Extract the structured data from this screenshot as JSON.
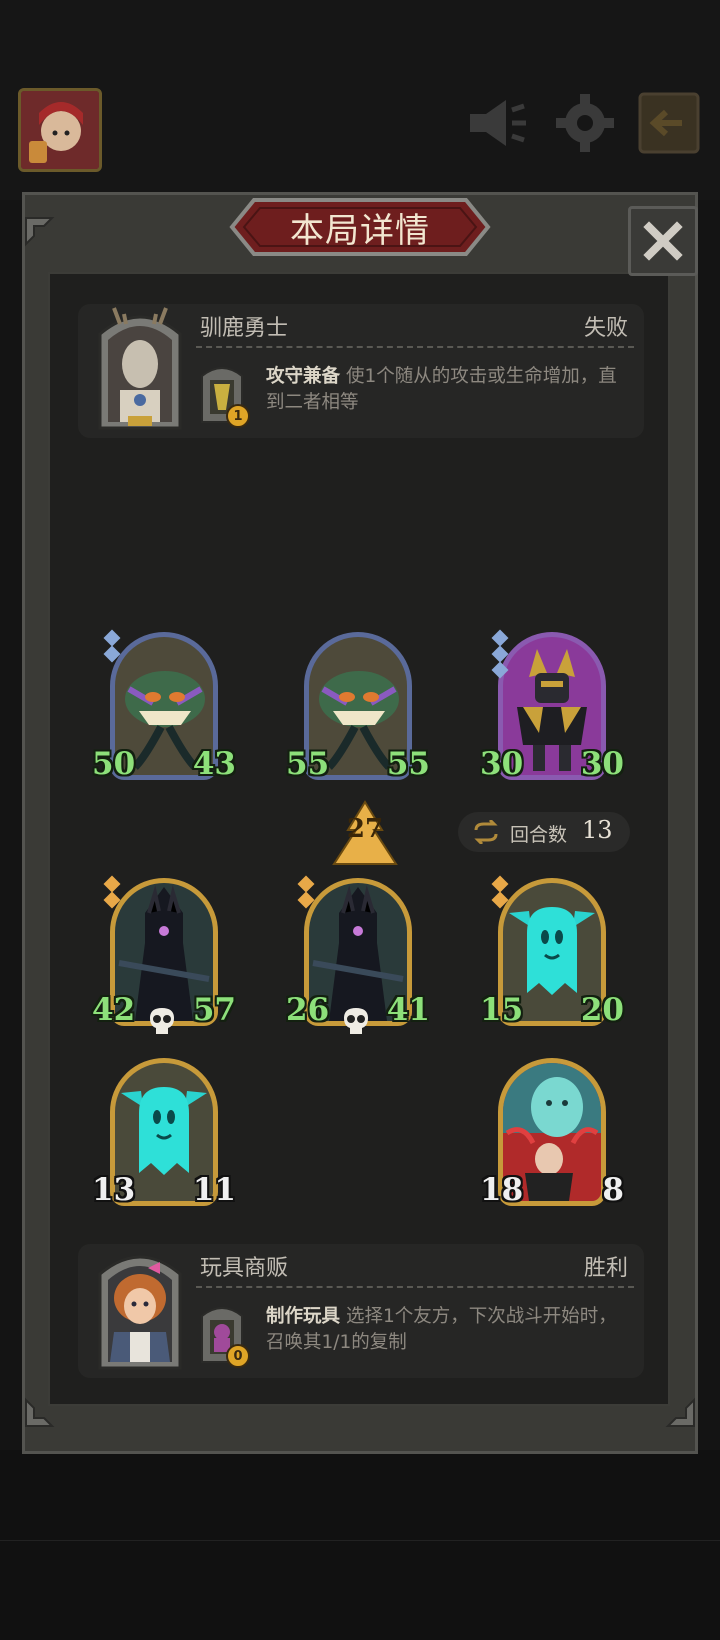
{
  "dialog": {
    "title": "本局详情"
  },
  "opponent": {
    "name": "驯鹿勇士",
    "result": "失败",
    "hero_power": {
      "name": "攻守兼备",
      "description": "使1个随从的攻击或生命增加，直到二者相等",
      "cost": "1"
    }
  },
  "player": {
    "name": "玩具商贩",
    "result": "胜利",
    "hero_power": {
      "name": "制作玩具",
      "description": "选择1个友方，下次战斗开始时，召唤其1/1的复制",
      "cost": "0"
    }
  },
  "tavern_tier": "27",
  "turns": {
    "label": "回合数",
    "value": "13"
  },
  "opponent_minions": [
    {
      "name": "purple-plant-monster",
      "attack": "50",
      "health": "43"
    },
    {
      "name": "purple-plant-monster",
      "attack": "55",
      "health": "55"
    },
    {
      "name": "golden-robot",
      "attack": "30",
      "health": "30"
    }
  ],
  "player_minions": [
    {
      "name": "dark-knight",
      "attack": "42",
      "health": "57"
    },
    {
      "name": "dark-knight",
      "attack": "26",
      "health": "41"
    },
    {
      "name": "cyan-ghost",
      "attack": "15",
      "health": "20"
    },
    {
      "name": "cyan-ghost",
      "attack": "13",
      "health": "11"
    },
    {
      "name": "spectral-summoner",
      "attack": "18",
      "health": "8"
    }
  ],
  "colors": {
    "stat_green": "#8de07a",
    "frame_gold": "#c79a3a",
    "frame_blue": "#5a6a9a",
    "frame_purple": "#8a5ab0",
    "title_red": "#6e1e1e"
  },
  "icons": [
    "settings-icon",
    "sound-off-icon",
    "exit-icon",
    "close-icon",
    "turns-icon",
    "tier-icon",
    "skull-icon"
  ]
}
